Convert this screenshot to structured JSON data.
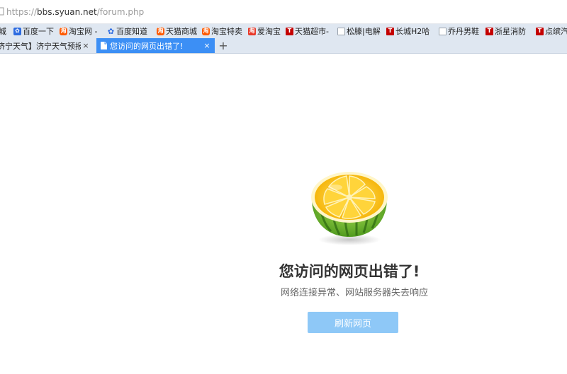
{
  "address_bar": {
    "scheme": "https://",
    "host": "bbs.syuan.net",
    "path": "/forum.php"
  },
  "bookmarks": [
    {
      "label": "城",
      "icon": "none"
    },
    {
      "label": "百度一下",
      "icon": "baidu-paw-icon"
    },
    {
      "label": "淘宝网 -",
      "icon": "taobao-icon"
    },
    {
      "label": "百度知道",
      "icon": "baidu-paw-icon"
    },
    {
      "label": "天猫商城",
      "icon": "taobao-icon"
    },
    {
      "label": "淘宝特卖",
      "icon": "taobao-icon"
    },
    {
      "label": "爱淘宝",
      "icon": "ai-taobao-icon"
    },
    {
      "label": "天猫超市-",
      "icon": "tmall-icon"
    },
    {
      "label": "松滕|电解",
      "icon": "page-icon"
    },
    {
      "label": "长城H2哈",
      "icon": "tmall-icon"
    },
    {
      "label": "乔丹男鞋",
      "icon": "page-icon"
    },
    {
      "label": "浙星消防",
      "icon": "tmall-icon"
    },
    {
      "label": "点缤汽",
      "icon": "tmall-icon"
    }
  ],
  "icon_glyphs": {
    "taobao": "淘",
    "ai": "淘",
    "tmall": "T",
    "baidu_paw": "✿"
  },
  "tabs": [
    {
      "label": "济宁天气】济宁天气预报",
      "active": false
    },
    {
      "label": "您访问的网页出错了!",
      "active": true
    }
  ],
  "tab_close_glyph": "×",
  "new_tab_glyph": "+",
  "error": {
    "title": "您访问的网页出错了!",
    "subtitle": "网络连接异常、网站服务器失去响应",
    "refresh_label": "刷新网页"
  },
  "colors": {
    "active_tab": "#3c8ff5",
    "tab_strip": "#dfe7f1",
    "refresh_button": "#8ec8f7"
  }
}
